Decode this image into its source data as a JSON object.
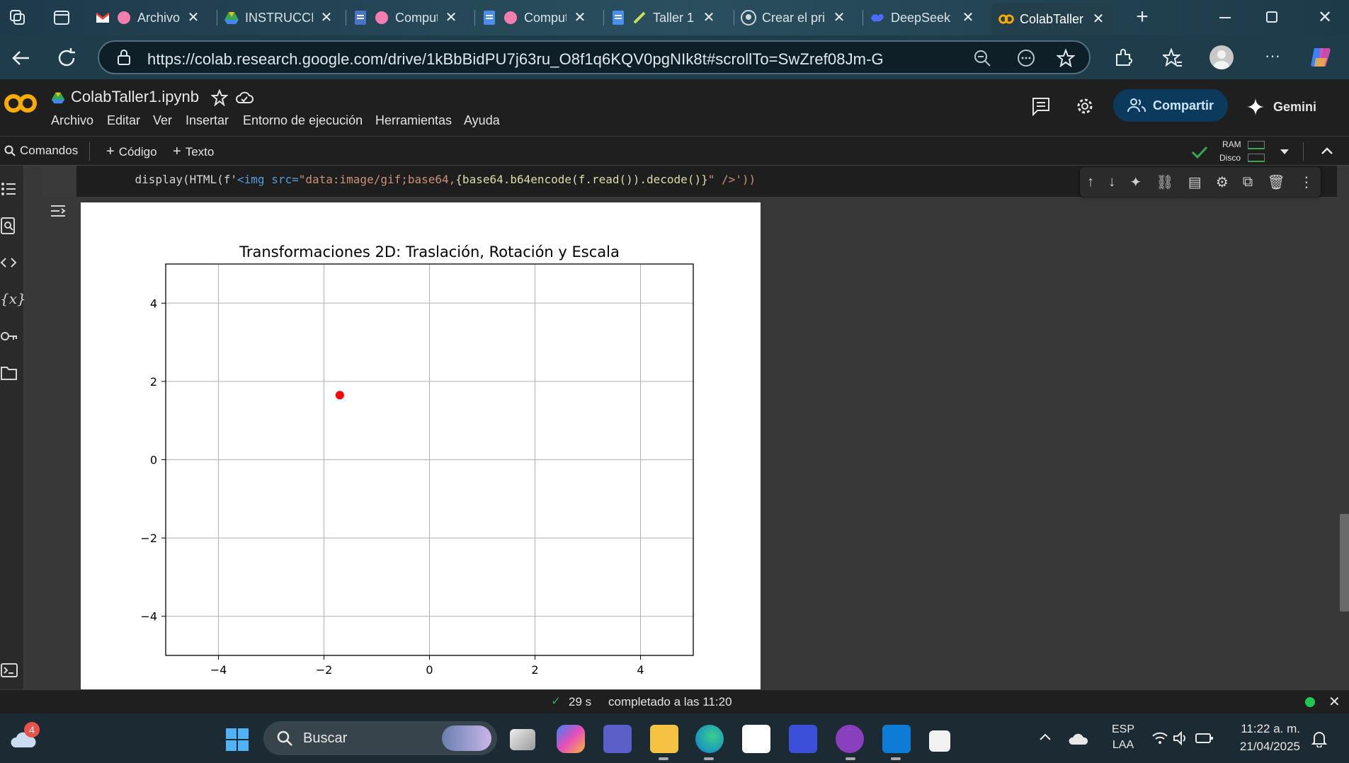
{
  "browser": {
    "tabs": [
      {
        "label": "Archivo",
        "icon": "gmail-icon"
      },
      {
        "label": "INSTRUCCIO",
        "icon": "drive-icon"
      },
      {
        "label": "Comput",
        "icon": "docs-icon"
      },
      {
        "label": "Comput",
        "icon": "docs-icon"
      },
      {
        "label": "Taller 1",
        "icon": "docs-icon"
      },
      {
        "label": "Crear el pri",
        "icon": "github-icon"
      },
      {
        "label": "DeepSeek",
        "icon": "deepseek-icon"
      },
      {
        "label": "ColabTaller",
        "icon": "colab-icon"
      }
    ],
    "url": "https://colab.research.google.com/drive/1kBbBidPU7j63ru_O8f1q6KQV0pgNIk8t#scrollTo=SwZref08Jm-G"
  },
  "colab": {
    "filename": "ColabTaller1.ipynb",
    "menu": [
      "Archivo",
      "Editar",
      "Ver",
      "Insertar",
      "Entorno de ejecución",
      "Herramientas",
      "Ayuda"
    ],
    "share_label": "Compartir",
    "gemini_label": "Gemini",
    "toolbar": {
      "commands_label": "Comandos",
      "code_label": "Código",
      "text_label": "Texto",
      "ram_label": "RAM",
      "disk_label": "Disco"
    },
    "code_line_prefix": "    display(HTML(f'",
    "code_line_tag": "<img src=",
    "code_line_str": "\"data:image/gif;base64,",
    "code_line_expr": "{base64.b64encode(f.read()).decode()}",
    "code_line_end": "\" />'))",
    "status": {
      "duration": "29 s",
      "completed": "completado a las 11:20"
    }
  },
  "chart_data": {
    "type": "scatter",
    "title": "Transformaciones 2D: Traslación, Rotación y Escala",
    "xlabel": "",
    "ylabel": "",
    "xlim": [
      -5,
      5
    ],
    "ylim": [
      -5,
      5
    ],
    "x_ticks": [
      "−4",
      "−2",
      "0",
      "2",
      "4"
    ],
    "y_ticks": [
      "4",
      "2",
      "0",
      "−2",
      "−4"
    ],
    "x_tick_values": [
      -4,
      -2,
      0,
      2,
      4
    ],
    "y_tick_values": [
      4,
      2,
      0,
      -2,
      -4
    ],
    "grid": true,
    "points": [
      {
        "x": -1.7,
        "y": 1.65,
        "color": "#ff0000"
      }
    ]
  },
  "taskbar": {
    "search_label": "Buscar",
    "weather_badge": "4",
    "lang_top": "ESP",
    "lang_bottom": "LAA",
    "time": "11:22 a. m.",
    "date": "21/04/2025"
  }
}
